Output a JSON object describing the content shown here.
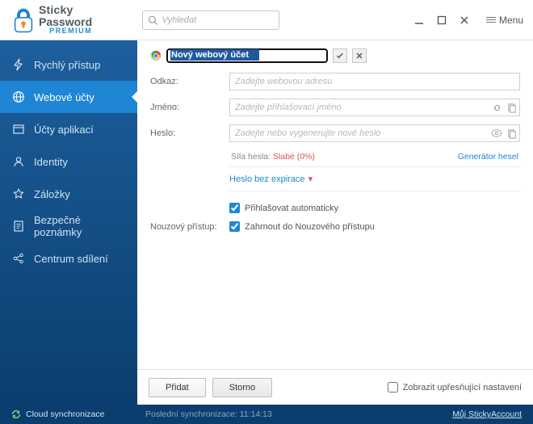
{
  "app": {
    "name_line1": "Sticky",
    "name_line2": "Password",
    "edition": "PREMIUM",
    "menu_label": "Menu"
  },
  "search": {
    "placeholder": "Vyhledat"
  },
  "sidebar": {
    "items": [
      {
        "label": "Rychlý přístup"
      },
      {
        "label": "Webové účty"
      },
      {
        "label": "Účty aplikací"
      },
      {
        "label": "Identity"
      },
      {
        "label": "Záložky"
      },
      {
        "label": "Bezpečné poznámky"
      },
      {
        "label": "Centrum sdílení"
      }
    ],
    "active_index": 1
  },
  "form": {
    "title_value": "Nový webový účet",
    "fields": {
      "link": {
        "label": "Odkaz:",
        "placeholder": "Zadejte webovou adresu"
      },
      "name": {
        "label": "Jméno:",
        "placeholder": "Zadejte přihlašovací jméno"
      },
      "password": {
        "label": "Heslo:",
        "placeholder": "Zadejte nebo vygenerujte nové heslo"
      }
    },
    "strength": {
      "label": "Síla hesla:",
      "value": "Slabé (0%)"
    },
    "generator_link": "Generátor hesel",
    "expire_text": "Heslo bez expirace",
    "auto_login": {
      "label": "Přihlašovat automaticky",
      "checked": true
    },
    "emergency": {
      "section_label": "Nouzový přístup:",
      "label": "Zahrnout do Nouzového přístupu",
      "checked": true
    }
  },
  "buttons": {
    "add": "Přidat",
    "cancel": "Storno",
    "show_advanced": "Zobrazit upřesňující nastavení"
  },
  "status": {
    "cloud_sync": "Cloud synchronizace",
    "last_sync_label": "Poslední synchronizace:",
    "last_sync_time": "11:14:13",
    "account_link": "Můj StickyAccount"
  }
}
